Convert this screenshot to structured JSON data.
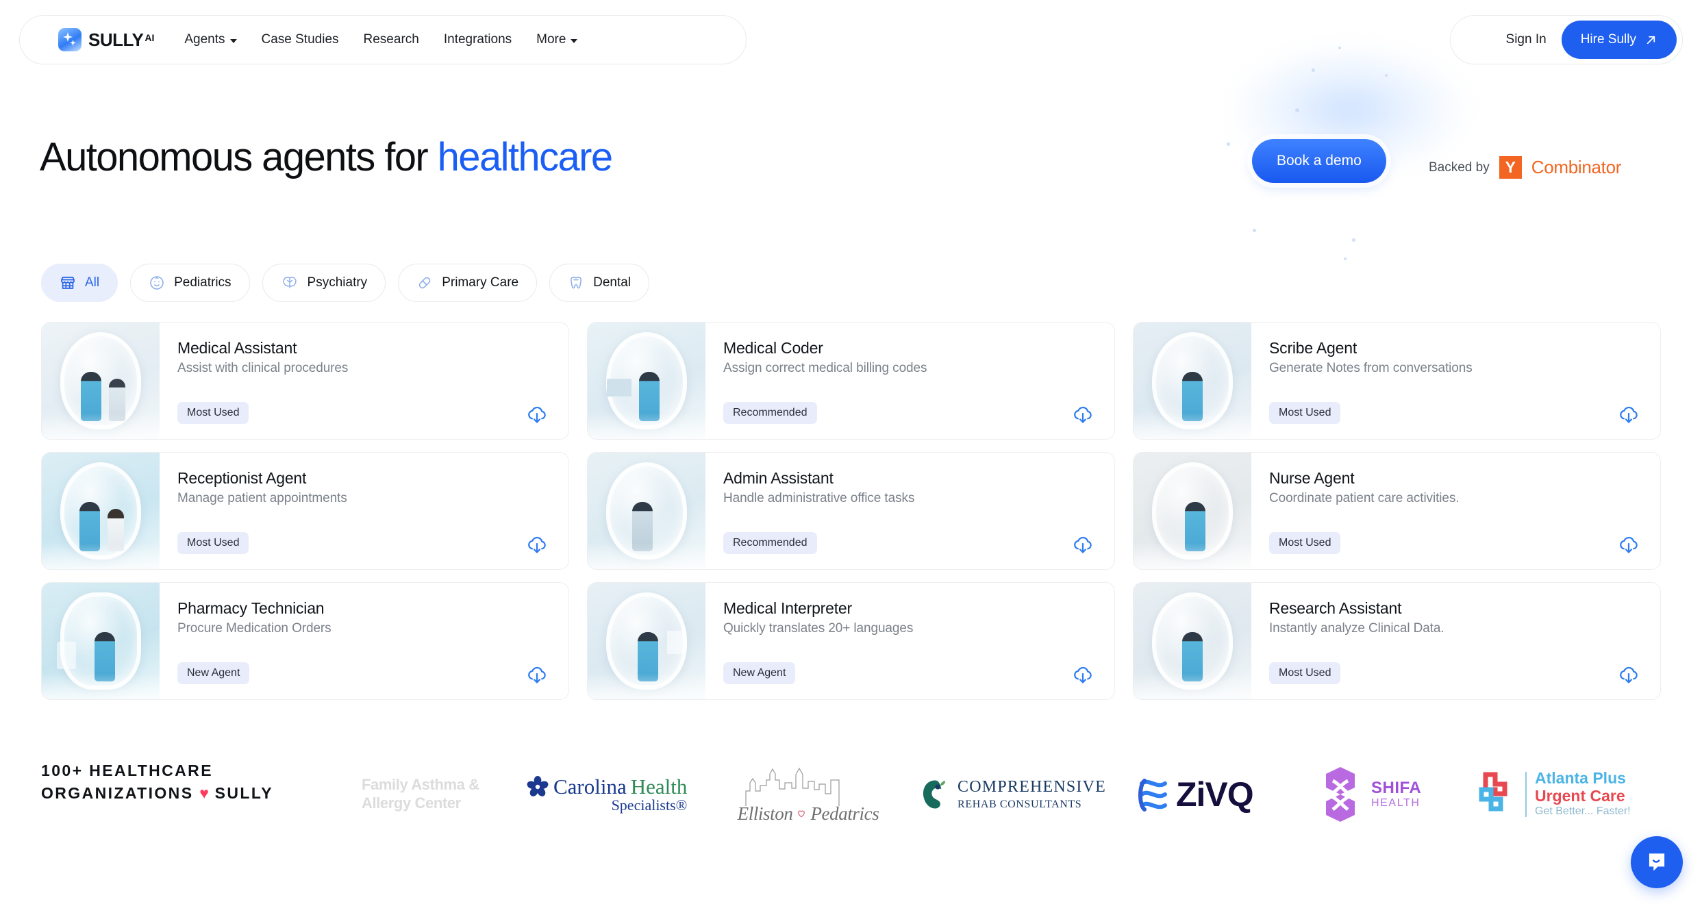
{
  "nav": {
    "brand": {
      "name": "SULLY",
      "superscript": "AI",
      "icon": "sully-logo-icon"
    },
    "links": [
      {
        "label": "Agents",
        "has_dropdown": true
      },
      {
        "label": "Case Studies",
        "has_dropdown": false
      },
      {
        "label": "Research",
        "has_dropdown": false
      },
      {
        "label": "Integrations",
        "has_dropdown": false
      },
      {
        "label": "More",
        "has_dropdown": true
      }
    ],
    "sign_in": "Sign In",
    "hire_cta": "Hire Sully",
    "hire_cta_icon": "arrow-up-right-icon"
  },
  "hero": {
    "title_prefix": "Autonomous agents for ",
    "title_accent": "healthcare",
    "demo_button": "Book a demo",
    "backed_by_label": "Backed by",
    "yc_letter": "Y",
    "yc_name": "Combinator",
    "accent_color": "#1a5ef5",
    "yc_color": "#f26522"
  },
  "filters": [
    {
      "label": "All",
      "icon": "storefront-icon",
      "active": true
    },
    {
      "label": "Pediatrics",
      "icon": "baby-face-icon",
      "active": false
    },
    {
      "label": "Psychiatry",
      "icon": "brain-icon",
      "active": false
    },
    {
      "label": "Primary Care",
      "icon": "capsule-pill-icon",
      "active": false
    },
    {
      "label": "Dental",
      "icon": "tooth-icon",
      "active": false
    }
  ],
  "agents": [
    {
      "title": "Medical Assistant",
      "desc": "Assist with clinical procedures",
      "badge": "Most Used",
      "thumb": "two-clinicians-pod-image"
    },
    {
      "title": "Medical Coder",
      "desc": "Assign correct medical billing codes",
      "badge": "Recommended",
      "thumb": "clinician-at-desk-pod-image"
    },
    {
      "title": "Scribe Agent",
      "desc": "Generate Notes from conversations",
      "badge": "Most Used",
      "thumb": "clinician-tablet-pod-image"
    },
    {
      "title": "Receptionist Agent",
      "desc": "Manage patient appointments",
      "badge": "Most Used",
      "thumb": "reception-desk-pod-image"
    },
    {
      "title": "Admin Assistant",
      "desc": "Handle administrative office tasks",
      "badge": "Recommended",
      "thumb": "admin-seated-pod-image"
    },
    {
      "title": "Nurse Agent",
      "desc": "Coordinate patient care activities.",
      "badge": "Most Used",
      "thumb": "nurse-standing-pod-image"
    },
    {
      "title": "Pharmacy Technician",
      "desc": "Procure Medication Orders",
      "badge": "New Agent",
      "thumb": "pharmacy-shelf-pod-image"
    },
    {
      "title": "Medical Interpreter",
      "desc": "Quickly translates 20+ languages",
      "badge": "New Agent",
      "thumb": "interpreter-pod-image"
    },
    {
      "title": "Research Assistant",
      "desc": "Instantly analyze Clinical Data.",
      "badge": "Most Used",
      "thumb": "researcher-laptop-pod-image"
    }
  ],
  "card_action_icon": "cloud-download-icon",
  "logos": {
    "headline_line1": "100+ HEALTHCARE",
    "headline_line2_pre": "ORGANIZATIONS ",
    "headline_heart": "♥",
    "headline_line2_post": " SULLY",
    "items": [
      {
        "name": "Family Asthma & Allergy Center",
        "line1": "Family Asthma &",
        "line2": "Allergy Center"
      },
      {
        "name": "Carolina Health Specialists",
        "line1": "Carolina",
        "line2": "Health",
        "line3": "Specialists®"
      },
      {
        "name": "Elliston Pediatrics",
        "line1": "Elliston",
        "line2": "Pedatrics"
      },
      {
        "name": "Comprehensive Rehab Consultants",
        "line1": "COMPREHENSIVE",
        "line2": "REHAB CONSULTANTS"
      },
      {
        "name": "Ziva",
        "line1": "ZiVQ"
      },
      {
        "name": "Shifa Health",
        "line1": "SHIFA",
        "line2": "HEALTH"
      },
      {
        "name": "Atlanta Plus Urgent Care",
        "line1": "Atlanta Plus",
        "line2": "Urgent Care",
        "line3": "Get Better... Faster!"
      }
    ]
  },
  "chat_widget": {
    "icon": "chat-smile-icon",
    "color": "#1f5ff0"
  }
}
